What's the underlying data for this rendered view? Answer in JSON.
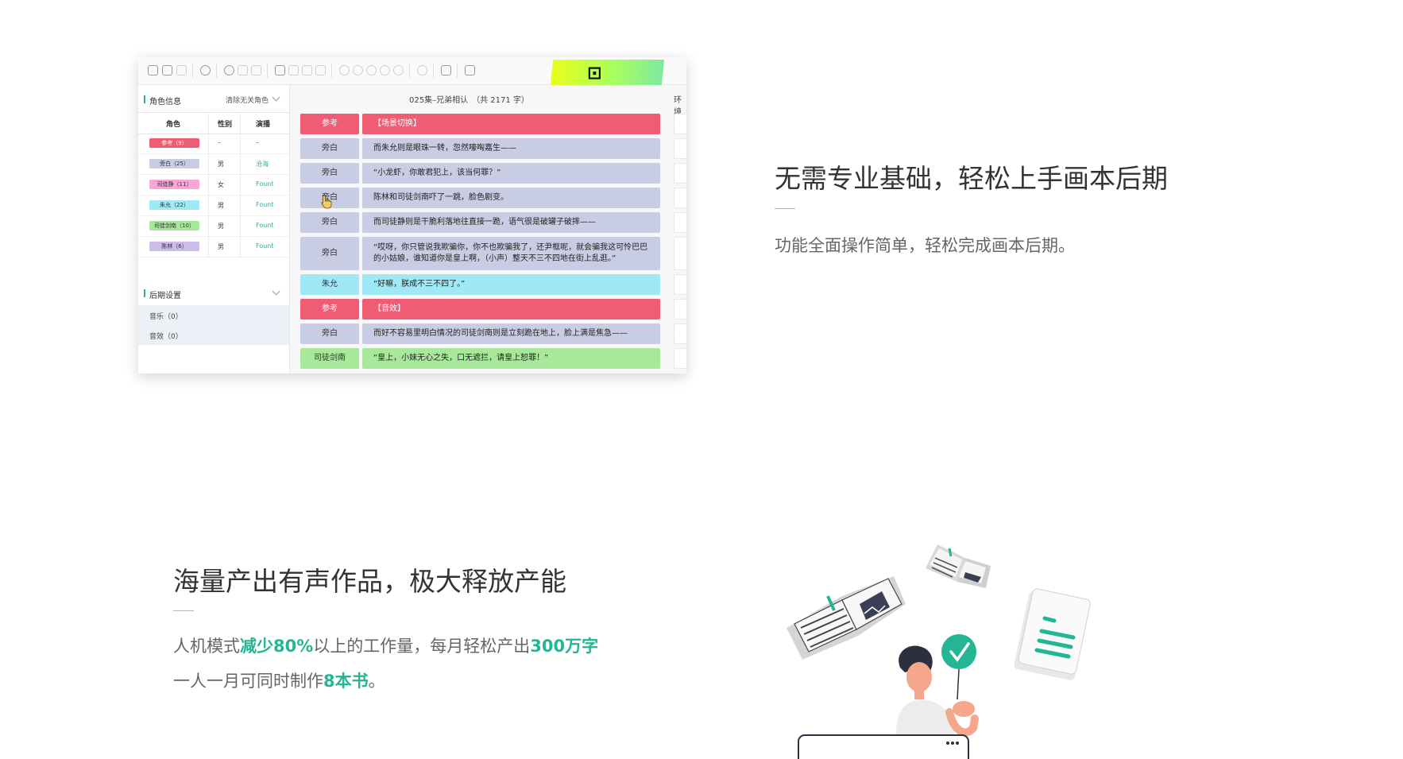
{
  "section1": {
    "heading": "无需专业基础，轻松上手画本后期",
    "description": "功能全面操作简单，轻松完成画本后期。"
  },
  "section2": {
    "heading": "海量产出有声作品，极大释放产能",
    "line1": {
      "pre": "人机模式",
      "hl1": "减少80%",
      "mid": "以上的工作量，每月轻松产出",
      "hl2": "300万字"
    },
    "line2": {
      "pre": "一人一月可同时制作",
      "hl": "8本书",
      "post": "。"
    }
  },
  "app": {
    "roles_header": "角色信息",
    "clear_unused_roles": "清除无关角色",
    "columns": [
      "角色",
      "性别",
      "演播"
    ],
    "roles": [
      {
        "tag": "参考（9）",
        "gender": "–",
        "narrator": "–",
        "color": "#ef5c74",
        "text_color": "#ffffff"
      },
      {
        "tag": "旁白（25）",
        "gender": "男",
        "narrator": "沧海",
        "color": "#c9cde3",
        "text_color": "#333333"
      },
      {
        "tag": "司徒静（11）",
        "gender": "女",
        "narrator": "Fount",
        "color": "#f7a6d6",
        "text_color": "#333333"
      },
      {
        "tag": "朱允（22）",
        "gender": "男",
        "narrator": "Fount",
        "color": "#9fe9f6",
        "text_color": "#333333"
      },
      {
        "tag": "司徒剑南（10）",
        "gender": "男",
        "narrator": "Fount",
        "color": "#a8e89a",
        "text_color": "#333333"
      },
      {
        "tag": "陈林（6）",
        "gender": "男",
        "narrator": "Fount",
        "color": "#cdbbe9",
        "text_color": "#333333"
      }
    ],
    "post_header": "后期设置",
    "post_items": [
      "音乐（0）",
      "音效（0）"
    ],
    "episode_title": "025集–兄弟相认　（共 2171 字）",
    "env_label": "环境",
    "script_rows": [
      {
        "name": "参考",
        "text": "【场景切换】",
        "color": "#ef5c74",
        "name_color": "#ffffff",
        "text_bg": "#ef5c74",
        "text_color": "#ffffff"
      },
      {
        "name": "旁白",
        "text": "而朱允则是眼珠一转，忽然嚎啕嘉生——",
        "color": "#c9cde3",
        "name_color": "#333333",
        "text_bg": "#c9cde3",
        "text_color": "#222222"
      },
      {
        "name": "旁白",
        "text": "“小龙虾，你敢君犯上，该当何罪？”",
        "color": "#c9cde3",
        "name_color": "#333333",
        "text_bg": "#c9cde3",
        "text_color": "#222222"
      },
      {
        "name": "旁白",
        "text": "陈林和司徒剑南吓了一跳，脸色剧变。",
        "color": "#c9cde3",
        "name_color": "#333333",
        "text_bg": "#c9cde3",
        "text_color": "#222222"
      },
      {
        "name": "旁白",
        "text": "而司徒静则是干脆利落地往直接一跪，语气很是破罐子破摔——",
        "color": "#c9cde3",
        "name_color": "#333333",
        "text_bg": "#c9cde3",
        "text_color": "#222222"
      },
      {
        "name": "旁白",
        "text": "“哎呀，你只管说我欺骗你，你不也欺骗我了，还尹框呢，就会骗我这可怜巴巴的小姑娘，谁知道你是皇上啊，（小声）整天不三不四地在街上乱逛。”",
        "color": "#c9cde3",
        "name_color": "#333333",
        "text_bg": "#c9cde3",
        "text_color": "#222222"
      },
      {
        "name": "朱允",
        "text": "“好嘛，朕成不三不四了。”",
        "color": "#9fe9f6",
        "name_color": "#333333",
        "text_bg": "#9fe9f6",
        "text_color": "#222222"
      },
      {
        "name": "参考",
        "text": "【音效】",
        "color": "#ef5c74",
        "name_color": "#ffffff",
        "text_bg": "#ef5c74",
        "text_color": "#ffffff"
      },
      {
        "name": "旁白",
        "text": "而好不容易里明白情况的司徒剑南则是立刻跪在地上，脸上满是焦急——",
        "color": "#c9cde3",
        "name_color": "#333333",
        "text_bg": "#c9cde3",
        "text_color": "#222222"
      },
      {
        "name": "司徒剑南",
        "text": "“皇上，小妹无心之失，口无遮拦，请皇上恕罪！”",
        "color": "#a8e89a",
        "name_color": "#333333",
        "text_bg": "#a8e89a",
        "text_color": "#222222"
      }
    ]
  },
  "colors": {
    "accent": "#23b594",
    "teal_marker": "#20b2a0"
  }
}
